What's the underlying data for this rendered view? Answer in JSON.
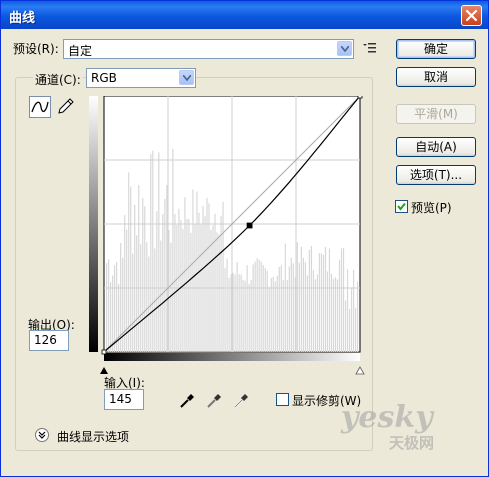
{
  "window": {
    "title": "曲线"
  },
  "preset": {
    "label": "预设(R):",
    "value": "自定"
  },
  "channel": {
    "label": "通道(C):",
    "value": "RGB"
  },
  "buttons": {
    "ok": "确定",
    "cancel": "取消",
    "smooth": "平滑(M)",
    "auto": "自动(A)",
    "options": "选项(T)..."
  },
  "preview": {
    "label": "预览(P)",
    "checked": true
  },
  "output": {
    "label": "输出(O):",
    "value": "126"
  },
  "input": {
    "label": "输入(I):",
    "value": "145"
  },
  "show_clipping": {
    "label": "显示修剪(W)",
    "checked": false
  },
  "curve_options": {
    "label": "曲线显示选项"
  },
  "icons": {
    "close": "close-icon",
    "preset_menu": "preset-menu-icon",
    "curve_tool": "curve-point-tool-icon",
    "pencil_tool": "pencil-tool-icon",
    "eyedroppers": [
      "black-eyedropper-icon",
      "gray-eyedropper-icon",
      "white-eyedropper-icon"
    ],
    "expand": "expand-chevron-icon"
  },
  "curve": {
    "points": [
      [
        0,
        0
      ],
      [
        145,
        126
      ],
      [
        255,
        255
      ]
    ]
  },
  "watermark": {
    "brand": "yesky",
    "sub": "天极网"
  },
  "colors": {
    "title_bar": "#0a5fe0",
    "curve": "#000000",
    "grid": "#cfcfcf",
    "histogram": "#d8d8d8"
  }
}
